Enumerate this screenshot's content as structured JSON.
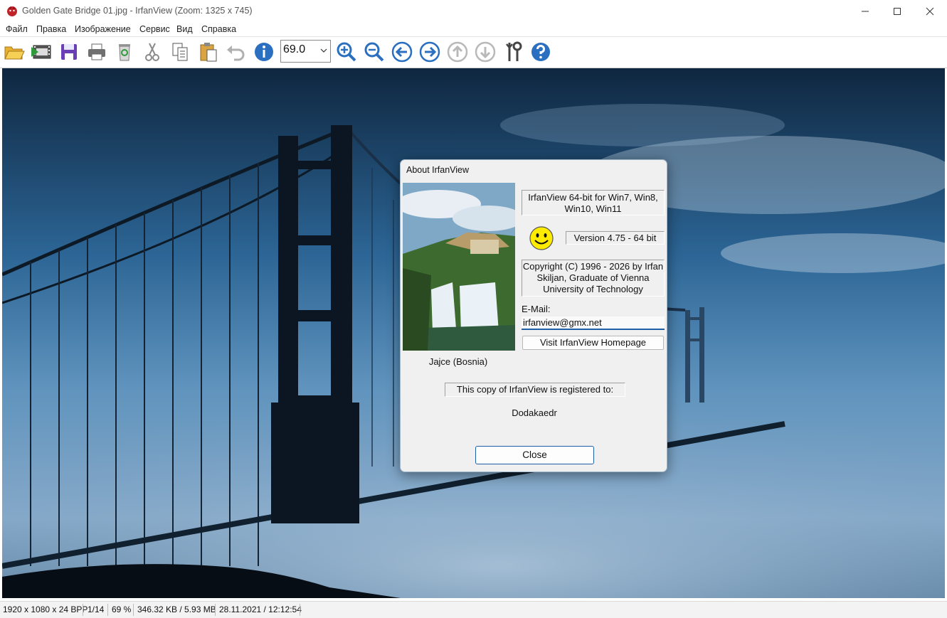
{
  "window": {
    "title": "Golden Gate Bridge 01.jpg - IrfanView (Zoom: 1325 x 745)",
    "app_icon": "irfanview-red-cat-icon",
    "controls": [
      "minimize-icon",
      "maximize-icon",
      "close-icon"
    ]
  },
  "menu": {
    "items": [
      "Файл",
      "Правка",
      "Изображение",
      "Сервис",
      "Вид",
      "Справка"
    ]
  },
  "toolbar": {
    "buttons": [
      "open-folder-icon",
      "slideshow-icon",
      "save-icon",
      "print-icon",
      "recycle-bin-icon",
      "cut-icon",
      "copy-icon",
      "paste-icon",
      "undo-icon",
      "info-icon"
    ],
    "zoom_value": "69.0",
    "nav_buttons": [
      "zoom-in-icon",
      "zoom-out-icon",
      "previous-icon",
      "next-icon",
      "up-icon",
      "down-icon",
      "settings-icon",
      "help-icon"
    ]
  },
  "dialog": {
    "title": "About  IrfanView",
    "picture_caption": "Jajce (Bosnia)",
    "product": "IrfanView 64-bit for Win7, Win8, Win10, Win11",
    "version": "Version 4.75 - 64 bit",
    "copyright": "Copyright (C) 1996 - 2026 by Irfan Skiljan, Graduate of Vienna University of Technology",
    "email_label": "E-Mail:",
    "email_value": "irfanview@gmx.net",
    "homepage_button": "Visit IrfanView Homepage",
    "registered_label": "This copy of IrfanView is registered to:",
    "registered_name": "Dodakaedr",
    "close_button": "Close"
  },
  "status": {
    "dimensions": "1920 x 1080 x 24 BPP",
    "index": "1/14",
    "zoom": "69 %",
    "size": "346.32 KB / 5.93 MB",
    "datetime": "28.11.2021 / 12:12:54"
  },
  "colors": {
    "accent_blue": "#1f5fa8",
    "dialog_bg": "#f0f0f0",
    "icon_blue": "#2a6fc0",
    "save_purple": "#6a3fb5"
  }
}
